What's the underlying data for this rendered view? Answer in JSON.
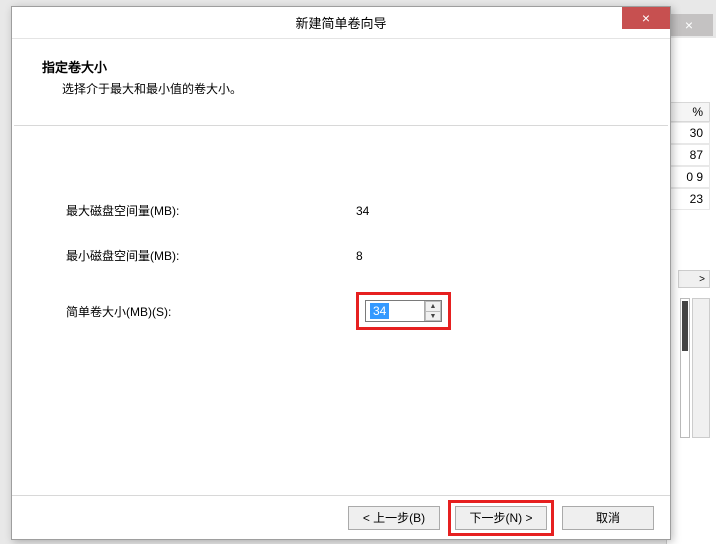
{
  "background": {
    "close_x": "×",
    "col_header": "%",
    "rows": [
      "30",
      "87",
      "0 9",
      "23"
    ],
    "scroll_right": ">"
  },
  "wizard": {
    "title": "新建简单卷向导",
    "close_x": "×",
    "heading": "指定卷大小",
    "subheading": "选择介于最大和最小值的卷大小。",
    "max_label": "最大磁盘空间量(MB):",
    "max_value": "34",
    "min_label": "最小磁盘空间量(MB):",
    "min_value": "8",
    "size_label": "简单卷大小(MB)(S):",
    "size_value": "34",
    "buttons": {
      "back": "< 上一步(B)",
      "next": "下一步(N) >",
      "cancel": "取消"
    }
  }
}
